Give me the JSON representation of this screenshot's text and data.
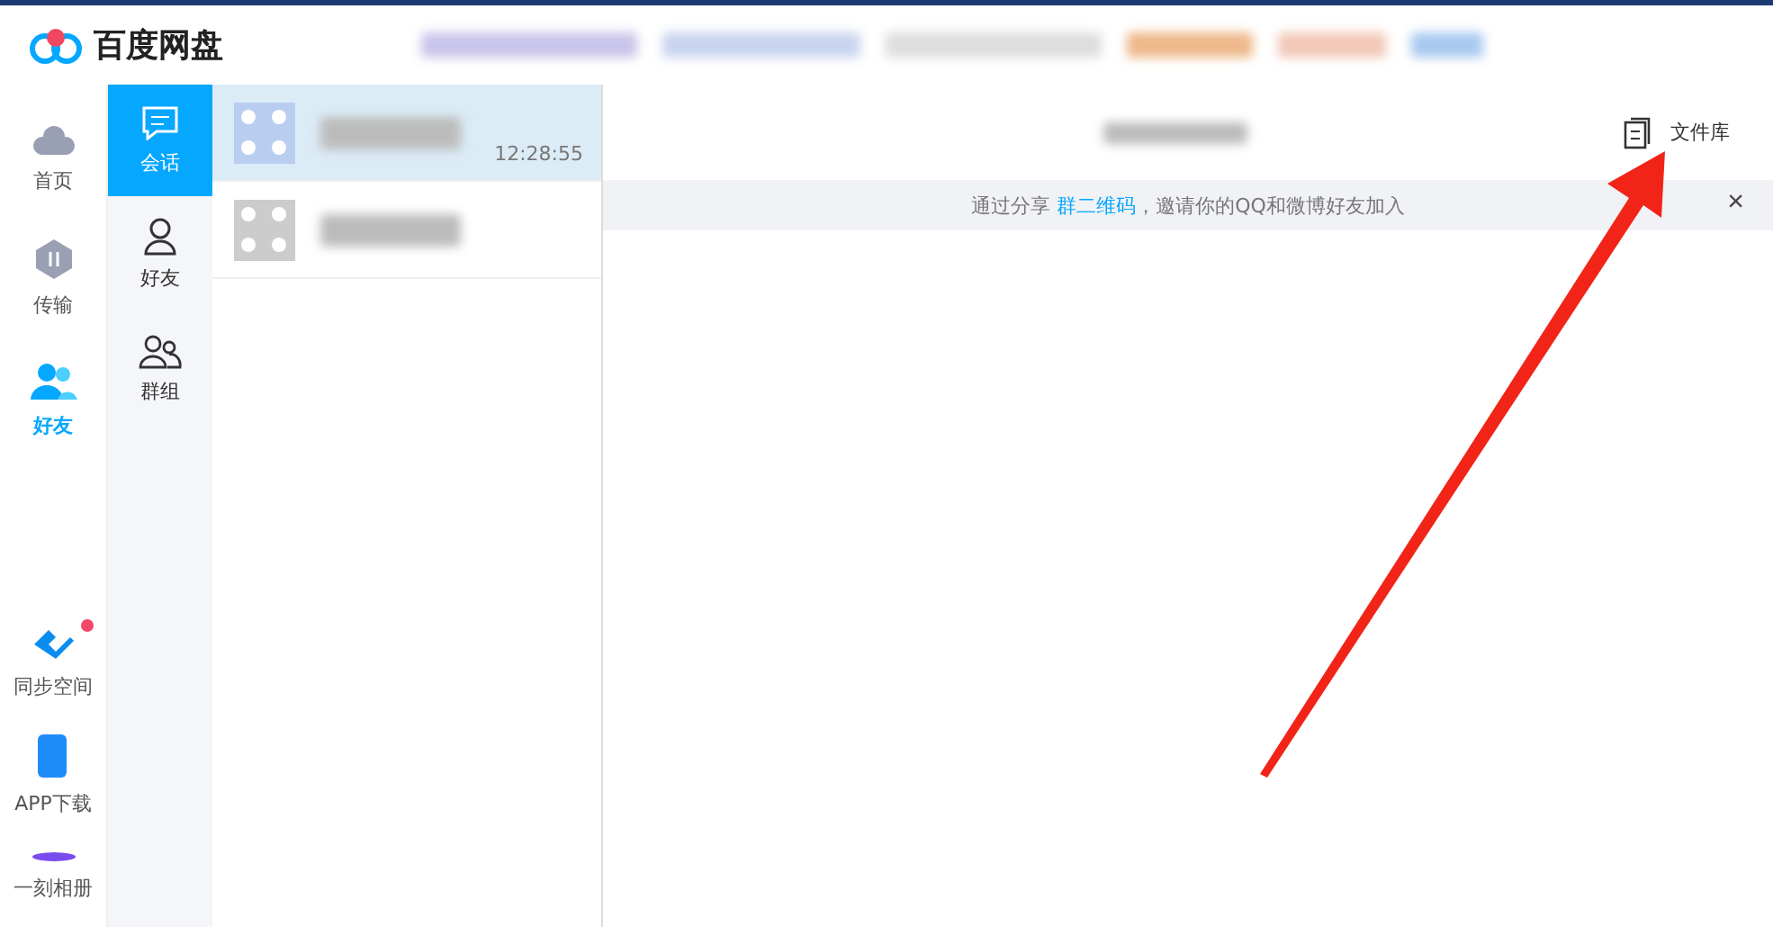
{
  "app": {
    "title": "百度网盘"
  },
  "nav": [
    {
      "label": "首页",
      "kind": "cloud",
      "selected": false
    },
    {
      "label": "传输",
      "kind": "transfer",
      "selected": false
    },
    {
      "label": "好友",
      "kind": "friends",
      "selected": true
    }
  ],
  "nav_bottom": [
    {
      "label": "同步空间",
      "kind": "sync",
      "badge": true
    },
    {
      "label": "APP下载",
      "kind": "phone",
      "badge": false
    },
    {
      "label": "一刻相册",
      "kind": "album",
      "badge": false
    }
  ],
  "tabs": [
    {
      "label": "会话",
      "kind": "chat",
      "selected": true
    },
    {
      "label": "好友",
      "kind": "person",
      "selected": false
    },
    {
      "label": "群组",
      "kind": "group",
      "selected": false
    }
  ],
  "conversations": [
    {
      "time": "12:28:55",
      "selected": true
    },
    {
      "selected": false
    }
  ],
  "toolbar": {
    "library": "文件库"
  },
  "banner": {
    "link": "群二维码",
    "before": "通过分享 ",
    "after": "，邀请你的QQ和微博好友加入",
    "close": "×"
  }
}
